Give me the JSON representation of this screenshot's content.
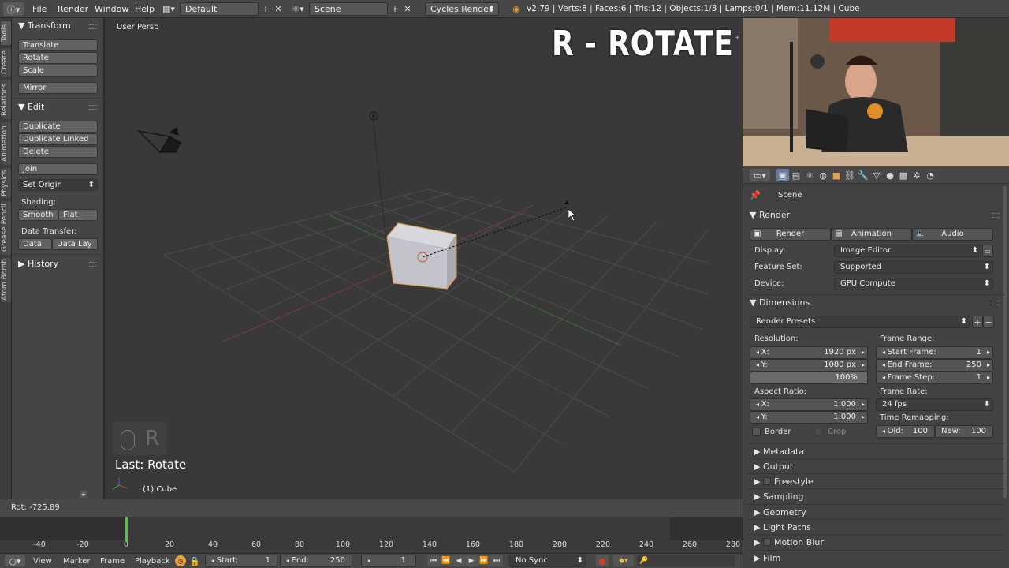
{
  "topbar": {
    "menus": [
      "File",
      "Render",
      "Window",
      "Help"
    ],
    "layout": "Default",
    "scene": "Scene",
    "engine": "Cycles Render",
    "stats": "v2.79 | Verts:8 | Faces:6 | Tris:12 | Objects:1/3 | Lamps:0/1 | Mem:11.12M | Cube"
  },
  "tabs": [
    "Tools",
    "Create",
    "Relations",
    "Animation",
    "Physics",
    "Grease Pencil",
    "Atom Bomb"
  ],
  "toolshelf": {
    "transform_title": "Transform",
    "translate": "Translate",
    "rotate": "Rotate",
    "scale": "Scale",
    "mirror": "Mirror",
    "edit_title": "Edit",
    "duplicate": "Duplicate",
    "duplicate_linked": "Duplicate Linked",
    "delete": "Delete",
    "join": "Join",
    "set_origin": "Set Origin",
    "shading_label": "Shading:",
    "smooth": "Smooth",
    "flat": "Flat",
    "data_transfer_label": "Data Transfer:",
    "data": "Data",
    "data_lay": "Data Lay",
    "history_title": "History"
  },
  "viewport": {
    "view_name": "User Persp",
    "overlay_text": "R - ROTATE",
    "key_glyph": "R",
    "last_op": "Last: Rotate",
    "object_label": "(1) Cube",
    "rot_readout": "Rot: -725.89"
  },
  "properties": {
    "scene_label": "Scene",
    "render_title": "Render",
    "render_btn": "Render",
    "animation_btn": "Animation",
    "audio_btn": "Audio",
    "display_label": "Display:",
    "display_value": "Image Editor",
    "feature_label": "Feature Set:",
    "feature_value": "Supported",
    "device_label": "Device:",
    "device_value": "GPU Compute",
    "dimensions_title": "Dimensions",
    "presets": "Render Presets",
    "resolution_label": "Resolution:",
    "res_x_label": "X:",
    "res_x": "1920 px",
    "res_y_label": "Y:",
    "res_y": "1080 px",
    "res_pct": "100%",
    "frame_range_label": "Frame Range:",
    "start_frame_label": "Start Frame:",
    "start_frame": "1",
    "end_frame_label": "End Frame:",
    "end_frame": "250",
    "frame_step_label": "Frame Step:",
    "frame_step": "1",
    "aspect_label": "Aspect Ratio:",
    "asp_x_label": "X:",
    "asp_x": "1.000",
    "asp_y_label": "Y:",
    "asp_y": "1.000",
    "frame_rate_label": "Frame Rate:",
    "frame_rate": "24 fps",
    "time_remap_label": "Time Remapping:",
    "old_label": "Old:",
    "old": "100",
    "new_label": "New:",
    "new": "100",
    "border": "Border",
    "crop": "Crop",
    "sections": [
      "Metadata",
      "Output",
      "Freestyle",
      "Sampling",
      "Geometry",
      "Light Paths",
      "Motion Blur",
      "Film"
    ]
  },
  "timeline": {
    "ticks": [
      "-40",
      "-20",
      "0",
      "20",
      "40",
      "60",
      "80",
      "100",
      "120",
      "140",
      "160",
      "180",
      "200",
      "220",
      "240",
      "260",
      "280"
    ],
    "menus": [
      "View",
      "Marker",
      "Frame",
      "Playback"
    ],
    "start_label": "Start:",
    "start": "1",
    "end_label": "End:",
    "end": "250",
    "current": "1",
    "sync": "No Sync"
  }
}
